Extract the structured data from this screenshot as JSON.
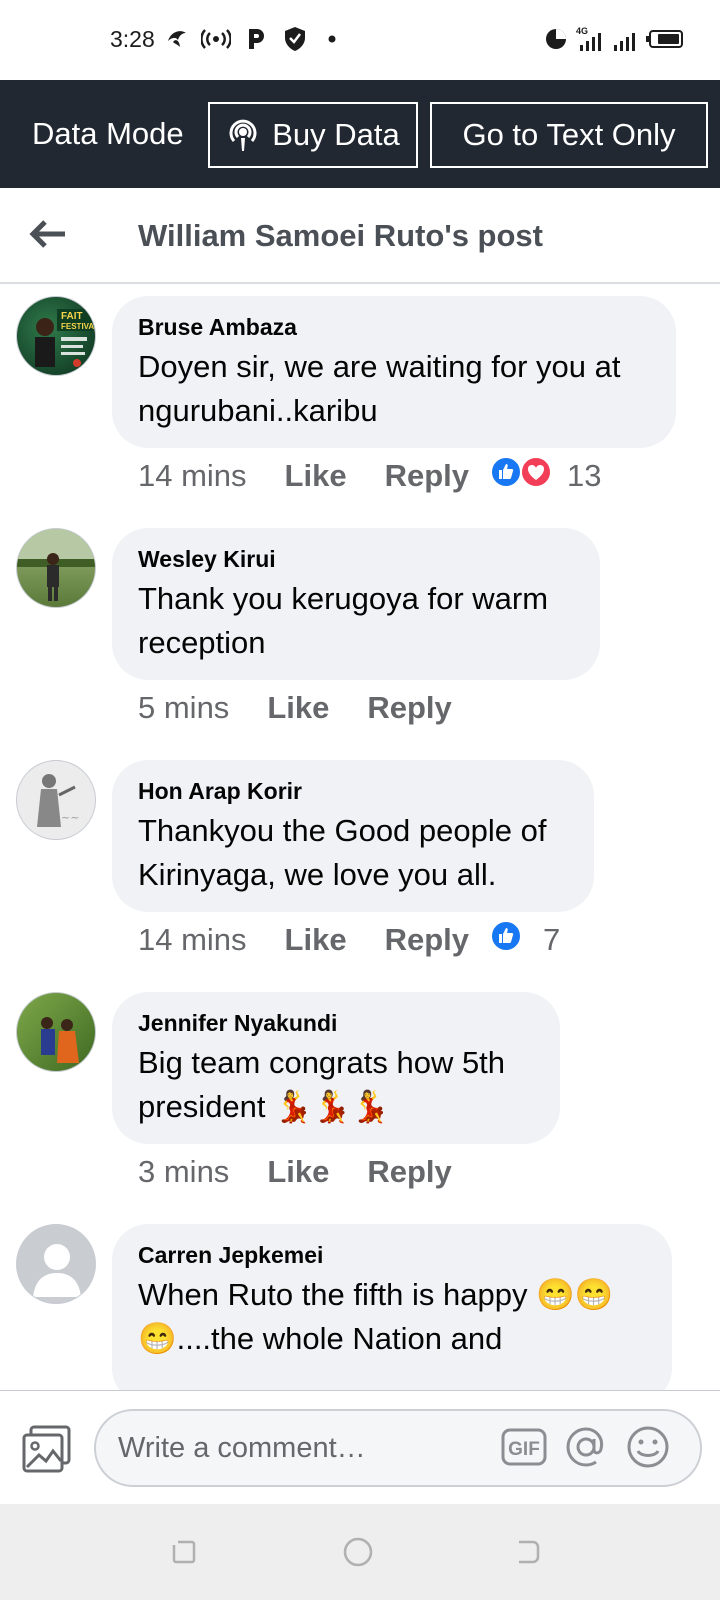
{
  "status_bar": {
    "time": "3:28",
    "network": "4G",
    "icons": [
      "bird-icon",
      "hotspot-icon",
      "p-icon",
      "shield-icon",
      "dot-icon",
      "data-saver-icon",
      "signal-icon",
      "signal-icon",
      "battery-icon"
    ]
  },
  "data_bar": {
    "mode_label": "Data Mode",
    "buy_data_label": "Buy Data",
    "text_only_label": "Go to Text Only"
  },
  "header": {
    "title": "William Samoei Ruto's post"
  },
  "comments": [
    {
      "author": "Bruse Ambaza",
      "text": "Doyen sir, we are waiting for you at ngurubani..karibu",
      "time": "14 mins",
      "like": "Like",
      "reply": "Reply",
      "reactions": [
        "like",
        "love"
      ],
      "reaction_count": "13",
      "avatar_colors": [
        "#1f5c3a",
        "#0b2e1c"
      ]
    },
    {
      "author": "Wesley Kirui",
      "text": "Thank you kerugoya for warm reception",
      "time": "5 mins",
      "like": "Like",
      "reply": "Reply",
      "reactions": [],
      "reaction_count": "",
      "avatar_colors": [
        "#8aa56a",
        "#4a6b2f"
      ]
    },
    {
      "author": "Hon Arap Korir",
      "text": "Thankyou the Good people of Kirinyaga, we love you all.",
      "time": "14 mins",
      "like": "Like",
      "reply": "Reply",
      "reactions": [
        "like"
      ],
      "reaction_count": "7",
      "avatar_colors": [
        "#e4e4e4",
        "#9a9a9a"
      ]
    },
    {
      "author": "Jennifer Nyakundi",
      "text": "Big team congrats how 5th president 💃💃💃",
      "time": "3 mins",
      "like": "Like",
      "reply": "Reply",
      "reactions": [],
      "reaction_count": "",
      "avatar_colors": [
        "#6b8f3a",
        "#c9611f"
      ]
    },
    {
      "author": "Carren Jepkemei",
      "text": "When Ruto the fifth is happy 😁😁😁....the whole Nation and",
      "time": "",
      "like": "",
      "reply": "",
      "reactions": [],
      "reaction_count": "",
      "avatar_colors": [
        "#c9ccd1",
        "#ffffff"
      ]
    }
  ],
  "composer": {
    "placeholder": "Write a comment…",
    "gif_label": "GIF"
  },
  "colors": {
    "data_bar_bg": "#222831",
    "bubble_bg": "#f0f2f5",
    "secondary_text": "#65676b",
    "like_blue": "#1877f2",
    "love_red": "#f33e58"
  }
}
